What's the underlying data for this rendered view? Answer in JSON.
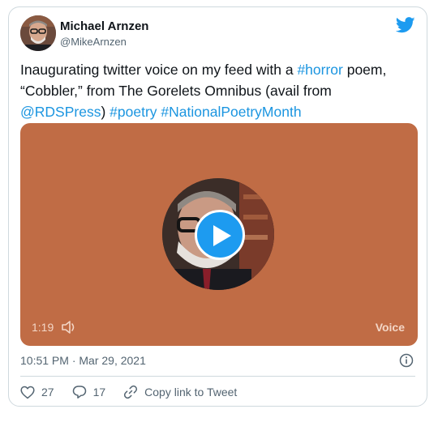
{
  "author": {
    "name": "Michael Arnzen",
    "handle": "@MikeArnzen"
  },
  "tweet": {
    "parts": [
      {
        "text": "Inaugurating twitter voice on my feed with a ",
        "link": false
      },
      {
        "text": "#horror",
        "link": true
      },
      {
        "text": " poem, “Cobbler,” from The Gorelets Omnibus (avail from ",
        "link": false
      },
      {
        "text": "@RDSPress",
        "link": true
      },
      {
        "text": ") ",
        "link": false
      },
      {
        "text": "#poetry",
        "link": true
      },
      {
        "text": " ",
        "link": false
      },
      {
        "text": "#NationalPoetryMonth",
        "link": true
      }
    ]
  },
  "voice": {
    "duration": "1:19",
    "label": "Voice",
    "background_color": "#c06c45"
  },
  "timestamp": "10:51 PM · Mar 29, 2021",
  "actions": {
    "likes": "27",
    "replies": "17",
    "copy_link": "Copy link to Tweet"
  },
  "colors": {
    "accent": "#1d9bf0",
    "link": "#1b95e0"
  },
  "icons": [
    "twitter-bird-icon",
    "play-icon",
    "speaker-icon",
    "info-icon",
    "heart-icon",
    "reply-icon",
    "link-icon"
  ]
}
